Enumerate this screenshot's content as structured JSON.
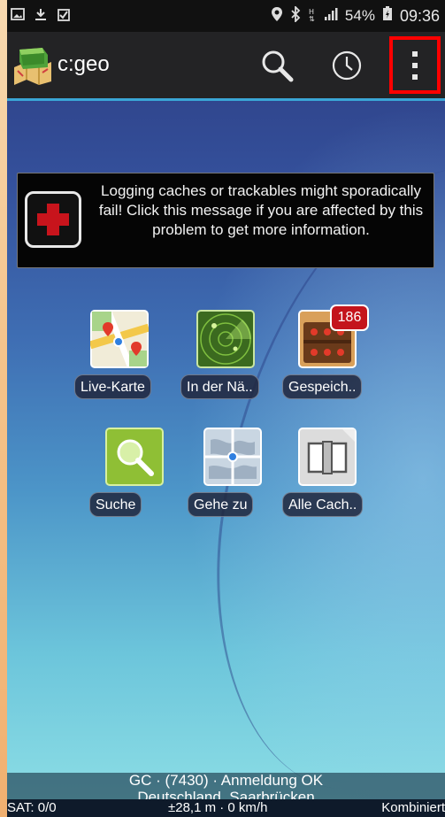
{
  "status_bar": {
    "icons_left": [
      "image-icon",
      "download-icon",
      "clipboard-check-icon"
    ],
    "icons_right": [
      "location-pin-icon",
      "bluetooth-icon",
      "hplus-icon",
      "signal-icon"
    ],
    "battery": "54%",
    "time": "09:36"
  },
  "action_bar": {
    "title": "c:geo",
    "accent": "#3aa6d6",
    "highlight": "#ff0000"
  },
  "banner": {
    "message": "Logging caches or trackables might sporadically fail! Click this message if you are affected by this problem to get more information.",
    "icon_color": "#c8141c"
  },
  "tiles": [
    {
      "label": "Live-Karte",
      "icon": "map-icon"
    },
    {
      "label": "In der Nä..",
      "icon": "radar-icon"
    },
    {
      "label": "Gespeich..",
      "icon": "treasure-chest-icon",
      "badge": "186"
    },
    {
      "label": "Suche",
      "icon": "search-tile-icon"
    },
    {
      "label": "Gehe zu",
      "icon": "globe-icon"
    },
    {
      "label": "Alle Cach..",
      "icon": "book-icon"
    }
  ],
  "footer": {
    "line1": "GC · (7430) · Anmeldung OK",
    "line2": "Deutschland, Saarbrücken",
    "satellites": "SAT: 0/0",
    "accuracy_speed": "±28,1 m · 0 km/h",
    "map_mode": "Kombiniert"
  }
}
